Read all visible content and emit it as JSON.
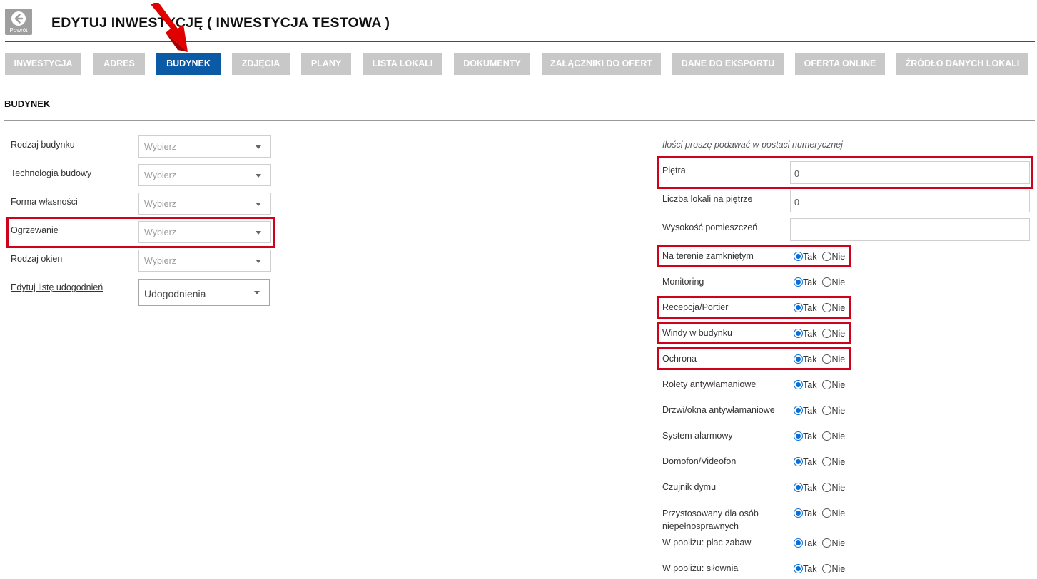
{
  "header": {
    "back_label": "Powrót",
    "title": "EDYTUJ INWESTYCJĘ ( INWESTYCJA TESTOWA )"
  },
  "tabs": [
    {
      "label": "INWESTYCJA",
      "active": false
    },
    {
      "label": "ADRES",
      "active": false
    },
    {
      "label": "BUDYNEK",
      "active": true
    },
    {
      "label": "ZDJĘCIA",
      "active": false
    },
    {
      "label": "PLANY",
      "active": false
    },
    {
      "label": "LISTA LOKALI",
      "active": false
    },
    {
      "label": "DOKUMENTY",
      "active": false
    },
    {
      "label": "ZAŁĄCZNIKI DO OFERT",
      "active": false
    },
    {
      "label": "DANE DO EKSPORTU",
      "active": false
    },
    {
      "label": "OFERTA ONLINE",
      "active": false
    },
    {
      "label": "ŹRÓDŁO DANYCH LOKALI",
      "active": false
    }
  ],
  "section_title": "BUDYNEK",
  "left_fields": [
    {
      "label": "Rodzaj budynku",
      "value": "Wybierz"
    },
    {
      "label": "Technologia budowy",
      "value": "Wybierz"
    },
    {
      "label": "Forma własności",
      "value": "Wybierz"
    },
    {
      "label": "Ogrzewanie",
      "value": "Wybierz"
    },
    {
      "label": "Rodzaj okien",
      "value": "Wybierz"
    }
  ],
  "amenities": {
    "link_label": "Edytuj listę udogodnień",
    "select_value": "Udogodnienia"
  },
  "right": {
    "hint": "Ilości proszę podawać w postaci numerycznej",
    "inputs": [
      {
        "label": "Piętra",
        "value": "0"
      },
      {
        "label": "Liczba lokali na piętrze",
        "value": "0"
      },
      {
        "label": "Wysokość pomieszczeń",
        "value": ""
      }
    ],
    "yes_label": "Tak",
    "no_label": "Nie",
    "radios": [
      {
        "label": "Na terenie zamkniętym",
        "selected": "Tak"
      },
      {
        "label": "Monitoring",
        "selected": "Tak"
      },
      {
        "label": "Recepcja/Portier",
        "selected": "Tak"
      },
      {
        "label": "Windy w budynku",
        "selected": "Tak"
      },
      {
        "label": "Ochrona",
        "selected": "Tak"
      },
      {
        "label": "Rolety antywłamaniowe",
        "selected": "Tak"
      },
      {
        "label": "Drzwi/okna antywłamaniowe",
        "selected": "Tak"
      },
      {
        "label": "System alarmowy",
        "selected": "Tak"
      },
      {
        "label": "Domofon/Videofon",
        "selected": "Tak"
      },
      {
        "label": "Czujnik dymu",
        "selected": "Tak"
      },
      {
        "label": "Przystosowany dla osób niepełnosprawnych",
        "selected": "Tak"
      },
      {
        "label": "W pobliżu: plac zabaw",
        "selected": "Tak"
      },
      {
        "label": "W pobliżu: siłownia",
        "selected": "Tak"
      }
    ]
  },
  "colors": {
    "active_tab": "#0b5aa5",
    "inactive_tab": "#c8c8c8",
    "highlight": "#d0021b",
    "radio": "#0b6fd6"
  }
}
